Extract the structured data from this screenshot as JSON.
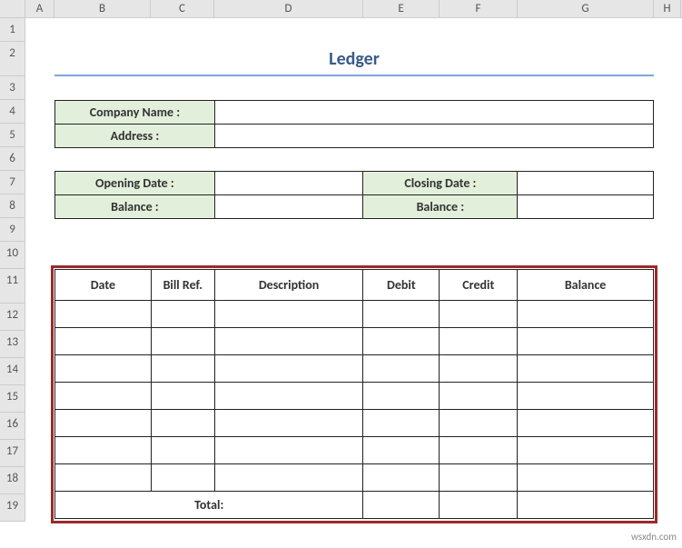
{
  "columns": [
    "A",
    "B",
    "C",
    "D",
    "E",
    "F",
    "G",
    "H"
  ],
  "rows": [
    "1",
    "2",
    "3",
    "4",
    "5",
    "6",
    "7",
    "8",
    "9",
    "10",
    "11",
    "12",
    "13",
    "14",
    "15",
    "16",
    "17",
    "18",
    "19"
  ],
  "title": "Ledger",
  "info_block": {
    "company_label": "Company Name :",
    "company_value": "",
    "address_label": "Address :",
    "address_value": ""
  },
  "dates_block": {
    "opening_date_label": "Opening Date :",
    "opening_date_value": "",
    "opening_balance_label": "Balance :",
    "opening_balance_value": "",
    "closing_date_label": "Closing Date :",
    "closing_date_value": "",
    "closing_balance_label": "Balance :",
    "closing_balance_value": ""
  },
  "ledger_table": {
    "headers": [
      "Date",
      "Bill Ref.",
      "Description",
      "Debit",
      "Credit",
      "Balance"
    ],
    "rows": [
      {
        "date": "",
        "billref": "",
        "description": "",
        "debit": "",
        "credit": "",
        "balance": ""
      },
      {
        "date": "",
        "billref": "",
        "description": "",
        "debit": "",
        "credit": "",
        "balance": ""
      },
      {
        "date": "",
        "billref": "",
        "description": "",
        "debit": "",
        "credit": "",
        "balance": ""
      },
      {
        "date": "",
        "billref": "",
        "description": "",
        "debit": "",
        "credit": "",
        "balance": ""
      },
      {
        "date": "",
        "billref": "",
        "description": "",
        "debit": "",
        "credit": "",
        "balance": ""
      },
      {
        "date": "",
        "billref": "",
        "description": "",
        "debit": "",
        "credit": "",
        "balance": ""
      },
      {
        "date": "",
        "billref": "",
        "description": "",
        "debit": "",
        "credit": "",
        "balance": ""
      }
    ],
    "total_label": "Total:",
    "total_debit": "",
    "total_credit": "",
    "total_balance": ""
  },
  "watermark": "wsxdn.com"
}
